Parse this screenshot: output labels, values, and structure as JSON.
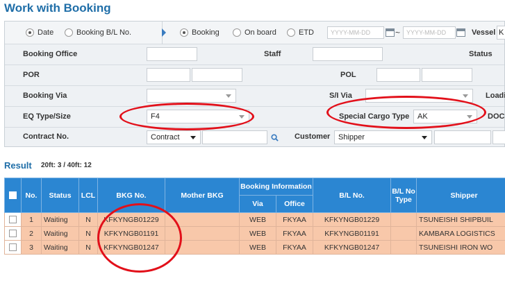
{
  "page": {
    "title": "Work with Booking"
  },
  "date_mode": {
    "options": [
      "Date",
      "Booking B/L No."
    ],
    "selected": "Date"
  },
  "status_mode": {
    "options": [
      "Booking",
      "On board",
      "ETD"
    ],
    "selected": "Booking"
  },
  "date_range": {
    "from_placeholder": "YYYY-MM-DD",
    "separator": "~",
    "to_placeholder": "YYYY-MM-DD"
  },
  "vessel": {
    "label": "Vessel",
    "value": "K"
  },
  "filters": {
    "booking_office": {
      "label": "Booking Office",
      "value": ""
    },
    "staff": {
      "label": "Staff",
      "value": ""
    },
    "status": {
      "label": "Status"
    },
    "por": {
      "label": "POR",
      "value": ""
    },
    "pol": {
      "label": "POL",
      "value": ""
    },
    "booking_via": {
      "label": "Booking Via",
      "value": ""
    },
    "si_via": {
      "label": "S/I Via",
      "value": ""
    },
    "loading": {
      "label": "Loadi"
    },
    "eq_type_size": {
      "label": "EQ Type/Size",
      "value": "F4"
    },
    "special_cargo_type": {
      "label": "Special Cargo Type",
      "value": "AK"
    },
    "doc": {
      "label": "DOC"
    },
    "contract_no": {
      "label": "Contract No.",
      "type_value": "Contract",
      "value": ""
    },
    "customer": {
      "label": "Customer",
      "type_value": "Shipper",
      "value": ""
    }
  },
  "result": {
    "title": "Result",
    "counts": "20ft: 3 / 40ft: 12",
    "columns": {
      "no": "No.",
      "status": "Status",
      "lcl": "LCL",
      "bkg_no": "BKG No.",
      "mother_bkg": "Mother BKG",
      "booking_information": "Booking Information",
      "via": "Via",
      "office": "Office",
      "bl_no": "B/L No.",
      "bl_no_type": "B/L No Type",
      "shipper": "Shipper"
    },
    "rows": [
      {
        "no": "1",
        "status": "Waiting",
        "lcl": "N",
        "bkg_no": "KFKYNGB01229",
        "mother_bkg": "",
        "via": "WEB",
        "office": "FKYAA",
        "bl_no": "KFKYNGB01229",
        "bl_type": "",
        "shipper": "TSUNEISHI SHIPBUIL"
      },
      {
        "no": "2",
        "status": "Waiting",
        "lcl": "N",
        "bkg_no": "KFKYNGB01191",
        "mother_bkg": "",
        "via": "WEB",
        "office": "FKYAA",
        "bl_no": "KFKYNGB01191",
        "bl_type": "",
        "shipper": "KAMBARA LOGISTICS"
      },
      {
        "no": "3",
        "status": "Waiting",
        "lcl": "N",
        "bkg_no": "KFKYNGB01247",
        "mother_bkg": "",
        "via": "WEB",
        "office": "FKYAA",
        "bl_no": "KFKYNGB01247",
        "bl_type": "",
        "shipper": "TSUNEISHI IRON WO"
      }
    ]
  },
  "colors": {
    "accent": "#1f6ea8",
    "header_bg": "#2b86d2",
    "highlight_row": "#f8c8aa",
    "annotation": "#e2101a"
  },
  "icons": [
    "calendar-icon",
    "search-icon",
    "chevron-down-icon"
  ]
}
